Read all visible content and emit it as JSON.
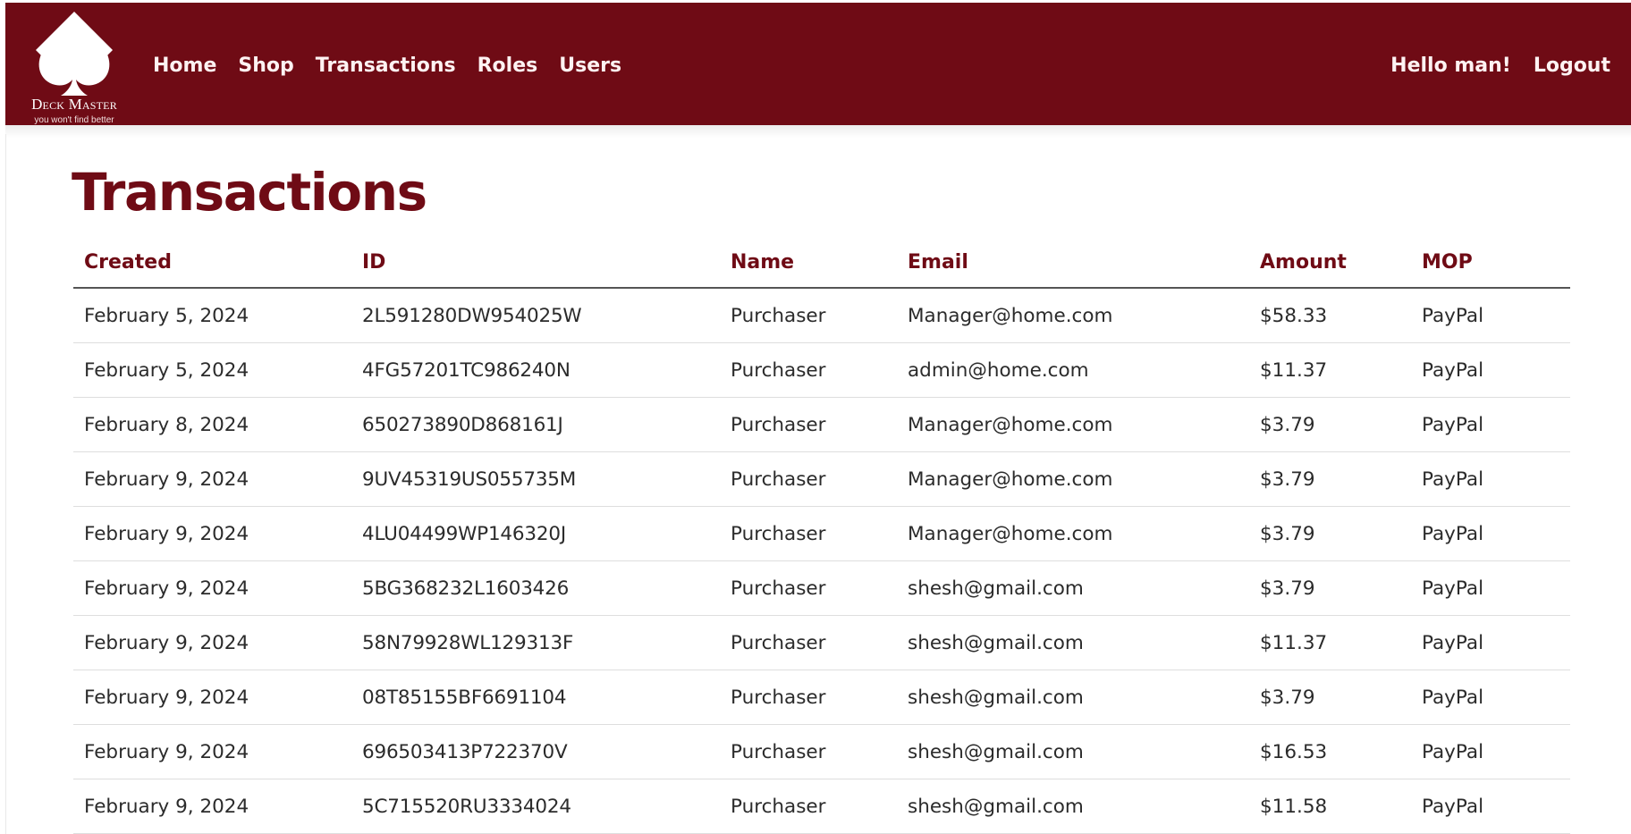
{
  "brand": {
    "name": "Deck Master",
    "tagline": "you won't find better"
  },
  "nav": {
    "items": [
      {
        "label": "Home"
      },
      {
        "label": "Shop"
      },
      {
        "label": "Transactions"
      },
      {
        "label": "Roles"
      },
      {
        "label": "Users"
      }
    ],
    "greeting": "Hello man!",
    "logout": "Logout"
  },
  "page": {
    "title": "Transactions"
  },
  "table": {
    "headers": [
      "Created",
      "ID",
      "Name",
      "Email",
      "Amount",
      "MOP"
    ],
    "rows": [
      [
        "February 5, 2024",
        "2L591280DW954025W",
        "Purchaser",
        "Manager@home.com",
        "$58.33",
        "PayPal"
      ],
      [
        "February 5, 2024",
        "4FG57201TC986240N",
        "Purchaser",
        "admin@home.com",
        "$11.37",
        "PayPal"
      ],
      [
        "February 8, 2024",
        "650273890D868161J",
        "Purchaser",
        "Manager@home.com",
        "$3.79",
        "PayPal"
      ],
      [
        "February 9, 2024",
        "9UV45319US055735M",
        "Purchaser",
        "Manager@home.com",
        "$3.79",
        "PayPal"
      ],
      [
        "February 9, 2024",
        "4LU04499WP146320J",
        "Purchaser",
        "Manager@home.com",
        "$3.79",
        "PayPal"
      ],
      [
        "February 9, 2024",
        "5BG368232L1603426",
        "Purchaser",
        "shesh@gmail.com",
        "$3.79",
        "PayPal"
      ],
      [
        "February 9, 2024",
        "58N79928WL129313F",
        "Purchaser",
        "shesh@gmail.com",
        "$11.37",
        "PayPal"
      ],
      [
        "February 9, 2024",
        "08T85155BF6691104",
        "Purchaser",
        "shesh@gmail.com",
        "$3.79",
        "PayPal"
      ],
      [
        "February 9, 2024",
        "696503413P722370V",
        "Purchaser",
        "shesh@gmail.com",
        "$16.53",
        "PayPal"
      ],
      [
        "February 9, 2024",
        "5C715520RU3334024",
        "Purchaser",
        "shesh@gmail.com",
        "$11.58",
        "PayPal"
      ]
    ]
  },
  "colors": {
    "brand": "#6f0b15",
    "text": "#2b2b2b",
    "row_divider": "#dedede"
  },
  "icons": {
    "logo": "spade-icon"
  }
}
